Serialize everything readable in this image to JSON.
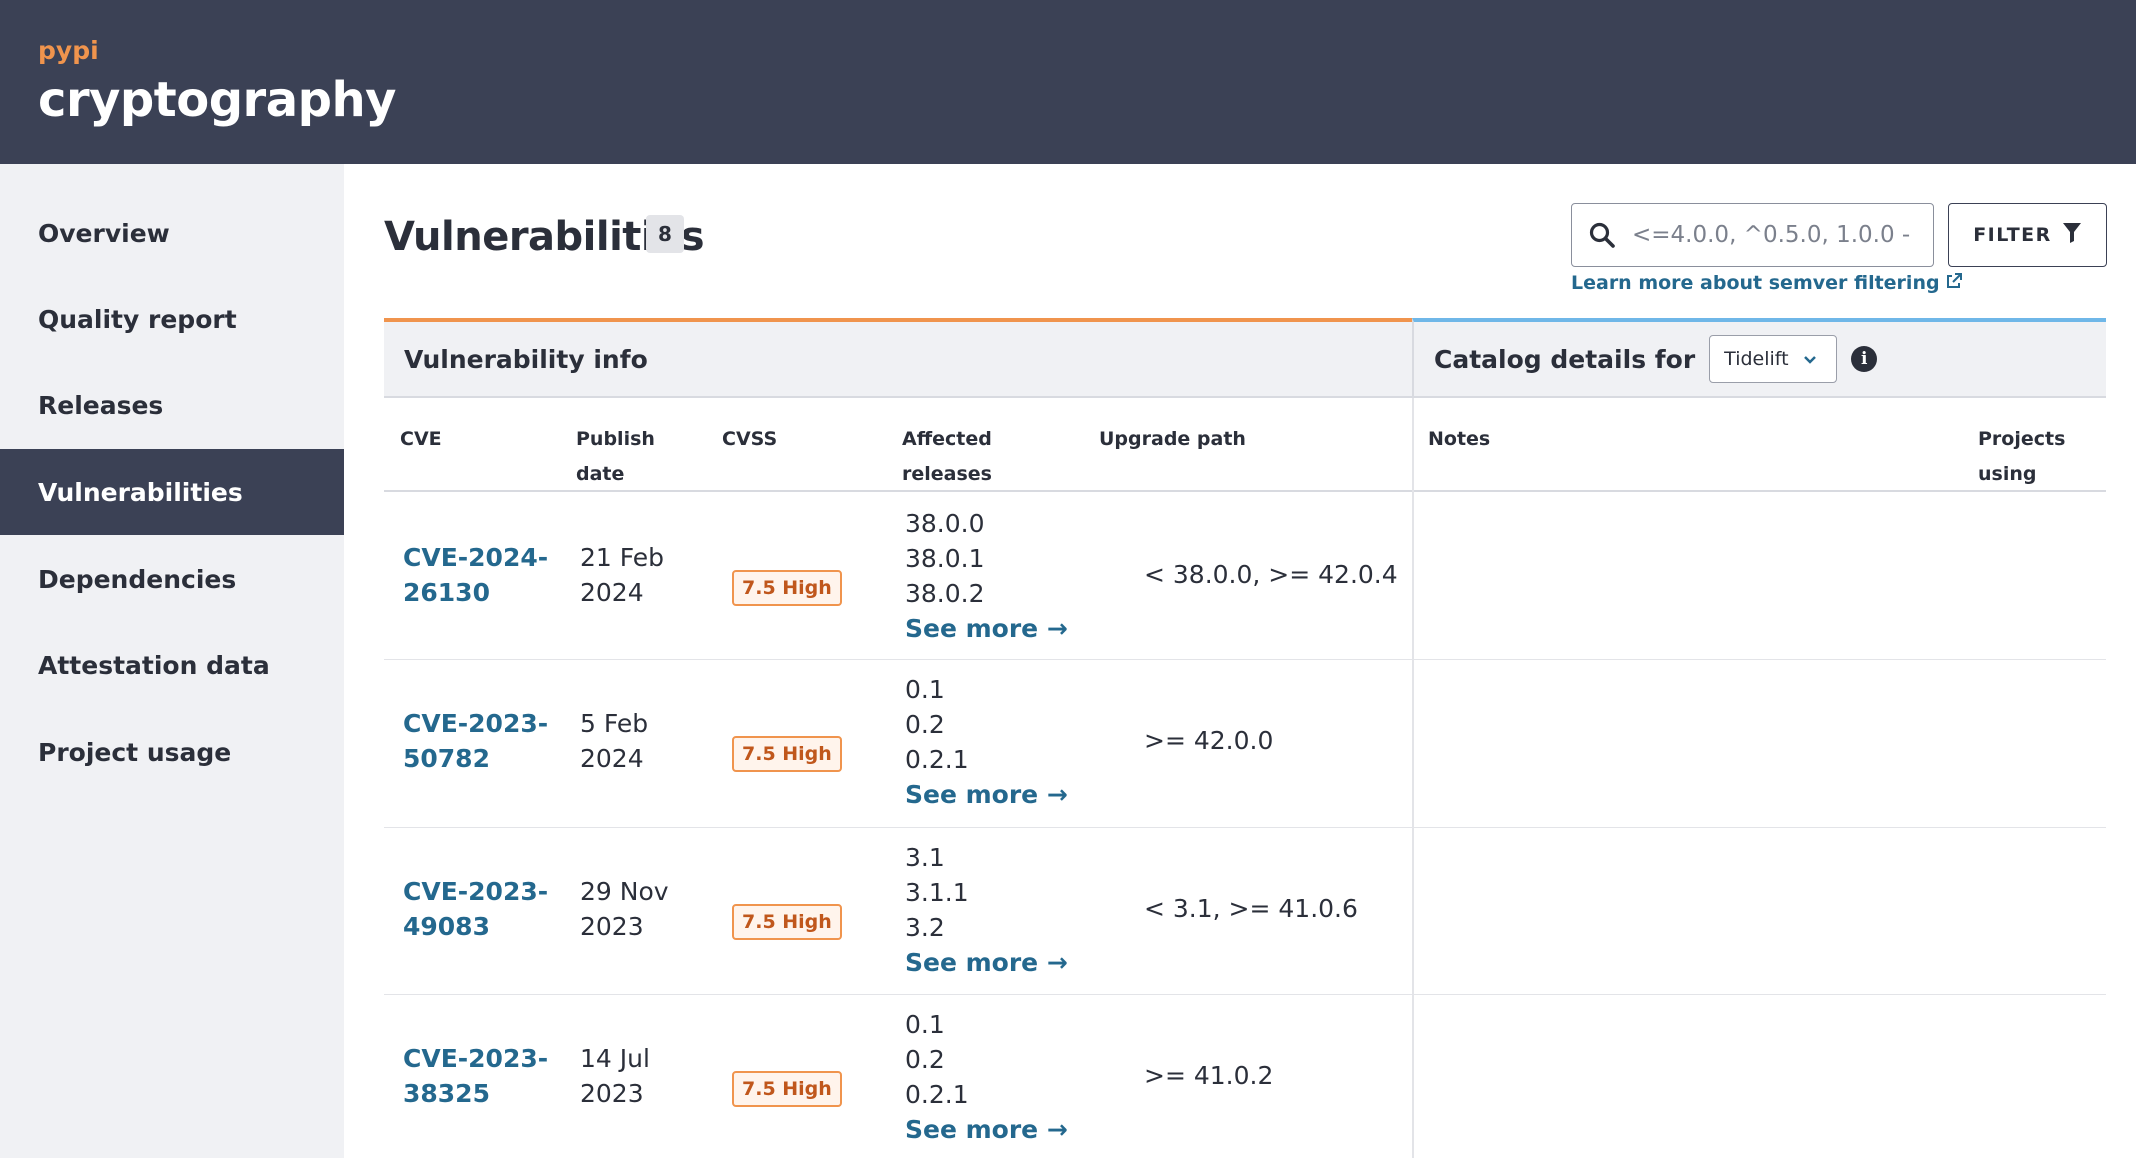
{
  "header": {
    "ecosystem": "pypi",
    "package": "cryptography"
  },
  "sidebar": {
    "items": [
      {
        "label": "Overview"
      },
      {
        "label": "Quality report"
      },
      {
        "label": "Releases"
      },
      {
        "label": "Vulnerabilities",
        "active": true
      },
      {
        "label": "Dependencies"
      },
      {
        "label": "Attestation data"
      },
      {
        "label": "Project usage"
      }
    ]
  },
  "main": {
    "title": "Vulnerabilities",
    "count": "8",
    "search": {
      "placeholder": "<=4.0.0, ^0.5.0, 1.0.0 -",
      "icon": "search-icon"
    },
    "filter_label": "FILTER",
    "semver_link": "Learn more about semver filtering"
  },
  "table": {
    "group_vuln": "Vulnerability info",
    "group_catalog": "Catalog details for",
    "catalog_select": "Tidelift",
    "columns": {
      "cve": "CVE",
      "publish_date_1": "Publish",
      "publish_date_2": "date",
      "cvss": "CVSS",
      "affected_1": "Affected",
      "affected_2": "releases",
      "upgrade": "Upgrade path",
      "notes": "Notes",
      "projects_1": "Projects",
      "projects_2": "using"
    },
    "see_more": "See more →",
    "rows": [
      {
        "cve_1": "CVE-2024-",
        "cve_2": "26130",
        "date_1": "21 Feb",
        "date_2": "2024",
        "cvss": "7.5 High",
        "affected": [
          "38.0.0",
          "38.0.1",
          "38.0.2"
        ],
        "upgrade": "< 38.0.0, >= 42.0.4"
      },
      {
        "cve_1": "CVE-2023-",
        "cve_2": "50782",
        "date_1": "5 Feb",
        "date_2": "2024",
        "cvss": "7.5 High",
        "affected": [
          "0.1",
          "0.2",
          "0.2.1"
        ],
        "upgrade": ">= 42.0.0"
      },
      {
        "cve_1": "CVE-2023-",
        "cve_2": "49083",
        "date_1": "29 Nov",
        "date_2": "2023",
        "cvss": "7.5 High",
        "affected": [
          "3.1",
          "3.1.1",
          "3.2"
        ],
        "upgrade": "< 3.1, >= 41.0.6"
      },
      {
        "cve_1": "CVE-2023-",
        "cve_2": "38325",
        "date_1": "14 Jul",
        "date_2": "2023",
        "cvss": "7.5 High",
        "affected": [
          "0.1",
          "0.2",
          "0.2.1"
        ],
        "upgrade": ">= 41.0.2"
      }
    ]
  },
  "colors": {
    "header_bg": "#3b4155",
    "accent_orange": "#f0944d",
    "accent_blue": "#6fb7e8",
    "link": "#24688e",
    "sidebar_bg": "#f0f1f4"
  }
}
